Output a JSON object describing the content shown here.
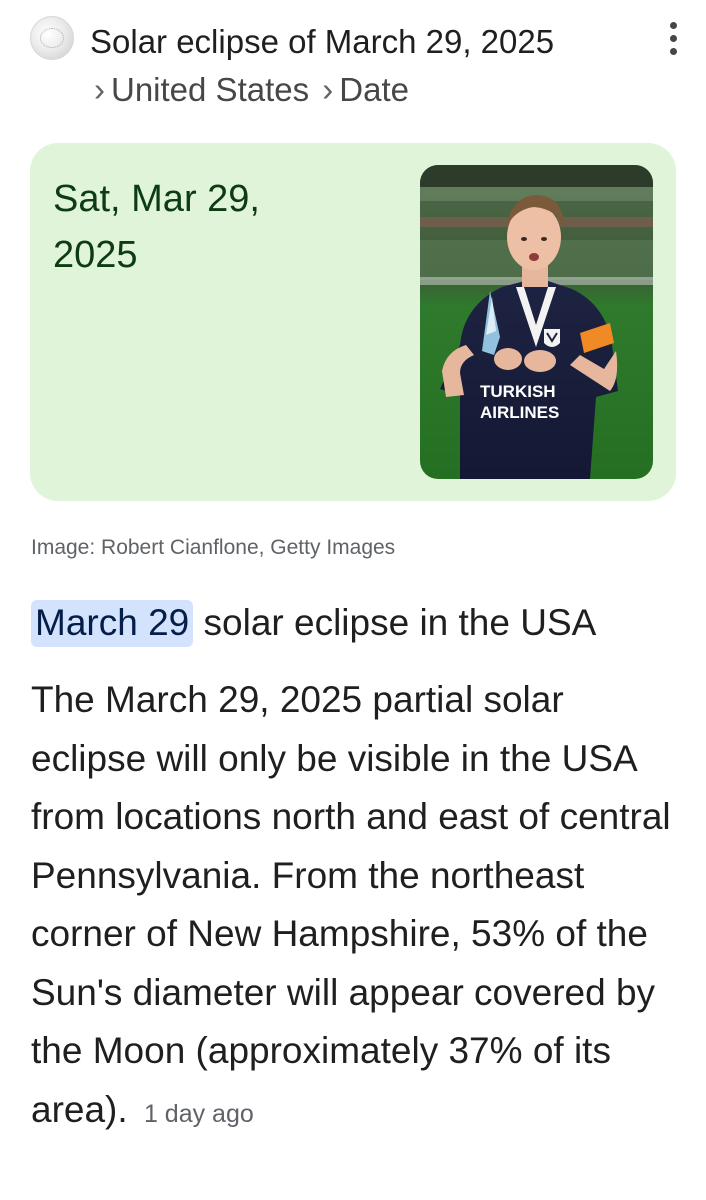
{
  "header": {
    "title": "Solar eclipse of March 29, 2025",
    "breadcrumbs": [
      "United States",
      "Date"
    ],
    "separator": "›"
  },
  "answer_card": {
    "date_text": "Sat, Mar 29, 2025",
    "background_color": "#e0f4d9",
    "image_jersey_text": "TURKISH AIRLINES"
  },
  "image_caption": "Image: Robert Cianflone, Getty Images",
  "snippet": {
    "heading_highlight": "March 29",
    "heading_rest": "solar eclipse in the USA",
    "body": "The March 29, 2025 partial solar eclipse will only be visible in the USA from locations north and east of central Pennsylvania. From the northeast corner of New Hampshire, 53% of the Sun's diameter will appear covered by the Moon (approximately 37% of its area).",
    "timestamp": "1 day ago"
  },
  "colors": {
    "highlight_bg": "#d3e3fd",
    "date_text": "#0d3c12",
    "secondary_text": "#5f6368"
  },
  "icons": [
    "site-favicon-icon",
    "more-options-icon"
  ]
}
